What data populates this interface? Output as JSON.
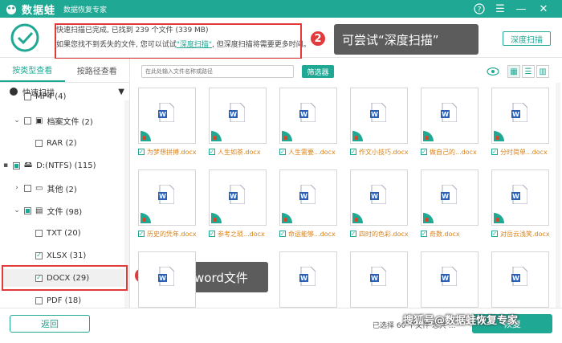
{
  "titlebar": {
    "app_name": "数据蛙",
    "subtitle": "数据恢复专家",
    "help_icon": "?",
    "menu_icon": "☰",
    "minimize": "—",
    "close": "✕"
  },
  "status": {
    "line1": "快速扫描已完成, 已找到 239 个文件 (339 MB)",
    "line2_pre": "如果您找不到丢失的文件, 您可以试试",
    "line2_link": "\"深度扫描\"",
    "line2_post": ", 但深度扫描将需要更多时间。",
    "deep_scan_button": "深度扫描"
  },
  "annotations": {
    "badge1": "1",
    "callout1": "选择word文件",
    "badge2": "2",
    "callout2": "可尝试“深度扫描”"
  },
  "sidebar": {
    "tab_type": "按类型查看",
    "tab_path": "按路径查看",
    "quick_scan": "快速扫描",
    "rows": [
      {
        "label": "MP4 (4)"
      },
      {
        "label": "档案文件 (2)"
      },
      {
        "label": "RAR (2)"
      },
      {
        "label": "D:(NTFS) (115)"
      },
      {
        "label": "其他 (2)"
      },
      {
        "label": "文件 (98)"
      },
      {
        "label": "TXT (20)"
      },
      {
        "label": "XLSX (31)"
      },
      {
        "label": "DOCX (29)"
      },
      {
        "label": "PDF (18)"
      }
    ]
  },
  "toolbar": {
    "search_placeholder": "在此处输入文件名称或路径",
    "filter_label": "筛选器"
  },
  "files_row1": [
    "为梦想拼搏.docx",
    "人生如茶.docx",
    "人生需要...docx",
    "作文小技巧.docx",
    "做自己的...docx",
    "分时简单...docx"
  ],
  "files_row2": [
    "历史的凭年.docx",
    "参考之琐...docx",
    "命运能够...docx",
    "四时的色彩.docx",
    "奇数.docx",
    "对岳云浅笑.docx"
  ],
  "files_row3": [
    "",
    "",
    "",
    "",
    "",
    ""
  ],
  "bottom": {
    "back_label": "返回",
    "selected_info": "已选择 60 个文件 总共 ...",
    "recover_label": "恢复"
  },
  "watermark": "搜狐号@数据蛙恢复专家",
  "colors": {
    "accent": "#1fa894",
    "annotation_red": "#e23a3a",
    "label_orange": "#d9831b"
  }
}
